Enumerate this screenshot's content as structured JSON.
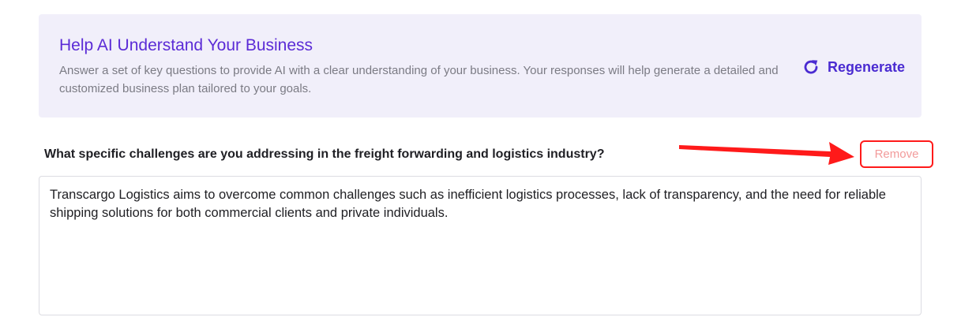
{
  "info_card": {
    "title": "Help AI Understand Your Business",
    "description": "Answer a set of key questions to provide AI with a clear understanding of your business. Your responses will help generate a detailed and customized business plan tailored to your goals.",
    "regenerate_label": "Regenerate",
    "regenerate_icon": "refresh-icon"
  },
  "question": {
    "text": "What specific challenges are you addressing in the freight forwarding and logistics industry?",
    "remove_label": "Remove",
    "answer": "Transcargo Logistics aims to overcome common challenges such as inefficient logistics processes, lack of transparency, and the need for reliable shipping solutions for both commercial clients and private individuals."
  },
  "colors": {
    "accent": "#5b2bd6",
    "card_background": "#f1effa",
    "annotation_red": "#ff1a1a",
    "remove_text": "#f29b9b"
  }
}
